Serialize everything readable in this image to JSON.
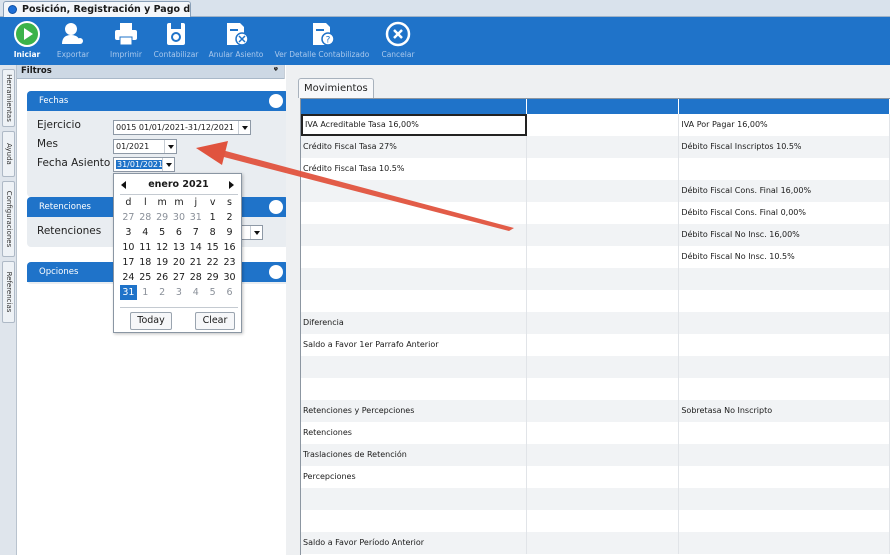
{
  "window": {
    "title": "Posición, Registración y Pago del ..."
  },
  "ribbon": {
    "buttons": [
      {
        "label": "Iniciar",
        "icon": "play-icon"
      },
      {
        "label": "Exportar",
        "icon": "user-export-icon"
      },
      {
        "label": "Imprimir",
        "icon": "printer-icon"
      },
      {
        "label": "Contabilizar",
        "icon": "save-ledger-icon"
      },
      {
        "label": "Anular Asiento",
        "icon": "cancel-entry-icon"
      },
      {
        "label": "Ver Detalle Contabilizado",
        "icon": "view-detail-icon"
      },
      {
        "label": "Cancelar",
        "icon": "cancel-circle-icon"
      }
    ]
  },
  "side_tabs": [
    "Herramientas",
    "Ayuda",
    "Configuraciones",
    "Referencias"
  ],
  "filters": {
    "title": "Filtros",
    "pin": "ᵠ",
    "fechas": {
      "title": "Fechas",
      "ejercicio_label": "Ejercicio",
      "ejercicio_value": "0015 01/01/2021-31/12/2021",
      "mes_label": "Mes",
      "mes_value": "01/2021",
      "fecha_asiento_label": "Fecha Asiento",
      "fecha_asiento_value": "31/01/2021"
    },
    "retenciones": {
      "title": "Retenciones",
      "label": "Retenciones"
    },
    "opciones": {
      "title": "Opciones"
    }
  },
  "calendar": {
    "month_label": "enero 2021",
    "days_of_week": [
      "d",
      "l",
      "m",
      "m",
      "j",
      "v",
      "s"
    ],
    "weeks": [
      [
        "27",
        "28",
        "29",
        "30",
        "31",
        "1",
        "2"
      ],
      [
        "3",
        "4",
        "5",
        "6",
        "7",
        "8",
        "9"
      ],
      [
        "10",
        "11",
        "12",
        "13",
        "14",
        "15",
        "16"
      ],
      [
        "17",
        "18",
        "19",
        "20",
        "21",
        "22",
        "23"
      ],
      [
        "24",
        "25",
        "26",
        "27",
        "28",
        "29",
        "30"
      ],
      [
        "31",
        "1",
        "2",
        "3",
        "4",
        "5",
        "6"
      ]
    ],
    "selected_day": "31",
    "today_label": "Today",
    "clear_label": "Clear"
  },
  "movimientos": {
    "tab_label": "Movimientos",
    "rows": [
      [
        "IVA Acreditable Tasa 16,00%",
        "",
        "IVA Por Pagar 16,00%"
      ],
      [
        "Crédito Fiscal Tasa 27%",
        "",
        "Débito Fiscal Inscriptos 10.5%"
      ],
      [
        "Crédito Fiscal Tasa 10.5%",
        "",
        ""
      ],
      [
        "",
        "",
        "Débito Fiscal Cons. Final 16,00%"
      ],
      [
        "",
        "",
        "Débito Fiscal Cons. Final 0,00%"
      ],
      [
        "",
        "",
        "Débito Fiscal No Insc. 16,00%"
      ],
      [
        "",
        "",
        "Débito Fiscal No Insc. 10.5%"
      ],
      [
        "",
        "",
        ""
      ],
      [
        "",
        "",
        ""
      ],
      [
        "Diferencia",
        "",
        ""
      ],
      [
        "Saldo a Favor 1er Parrafo Anterior",
        "",
        ""
      ],
      [
        "",
        "",
        ""
      ],
      [
        "",
        "",
        ""
      ],
      [
        "Retenciones y Percepciones",
        "",
        "Sobretasa No Inscripto"
      ],
      [
        "Retenciones",
        "",
        ""
      ],
      [
        "Traslaciones de Retención",
        "",
        ""
      ],
      [
        "Percepciones",
        "",
        ""
      ],
      [
        "",
        "",
        ""
      ],
      [
        "",
        "",
        ""
      ],
      [
        "Saldo a Favor Período Anterior",
        "",
        ""
      ]
    ]
  },
  "colors": {
    "accent": "#1f73c9",
    "annotation": "#e0533e"
  }
}
